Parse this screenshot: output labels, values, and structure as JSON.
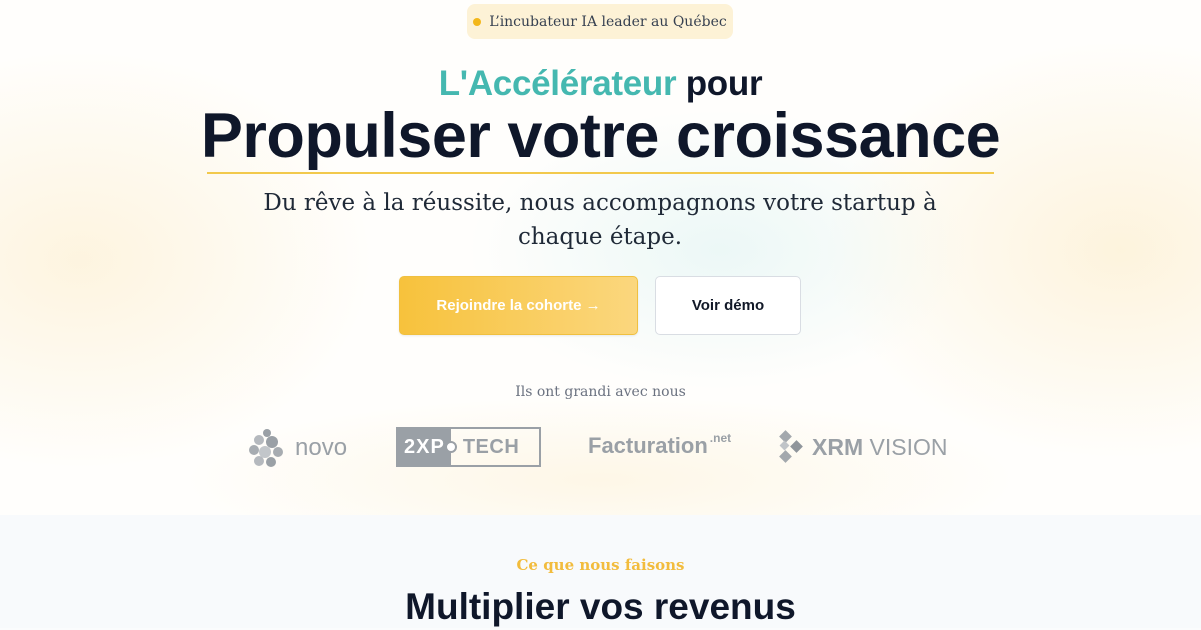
{
  "badge": {
    "text": "L’incubateur IA leader au Québec",
    "dot_color": "#f3b71a"
  },
  "hero": {
    "title_accent": "L'Accélérateur",
    "title_rest": " pour",
    "title_main": "Propulser votre croissance",
    "subtitle": "Du rêve à la réussite, nous accompagnons votre startup à chaque étape.",
    "accent_color": "#45b8b0",
    "underline_color": "#f2c94c"
  },
  "buttons": {
    "primary_label": "Rejoindre la cohorte →",
    "secondary_label": "Voir démo"
  },
  "partners": {
    "heading": "Ils ont grandi avec nous",
    "logos": [
      {
        "name": "novo",
        "icon": "novo-cluster-icon"
      },
      {
        "name_box": "2XP",
        "name_rest": "TECH"
      },
      {
        "name": "Facturation",
        "superscript": ".net"
      },
      {
        "name_bold": "XRM",
        "name_rest": " VISION",
        "icon": "xrm-diamond-icon"
      }
    ]
  },
  "section": {
    "kicker": "Ce que nous faisons",
    "title": "Multiplier vos revenus",
    "kicker_color": "#f2bc3d"
  }
}
